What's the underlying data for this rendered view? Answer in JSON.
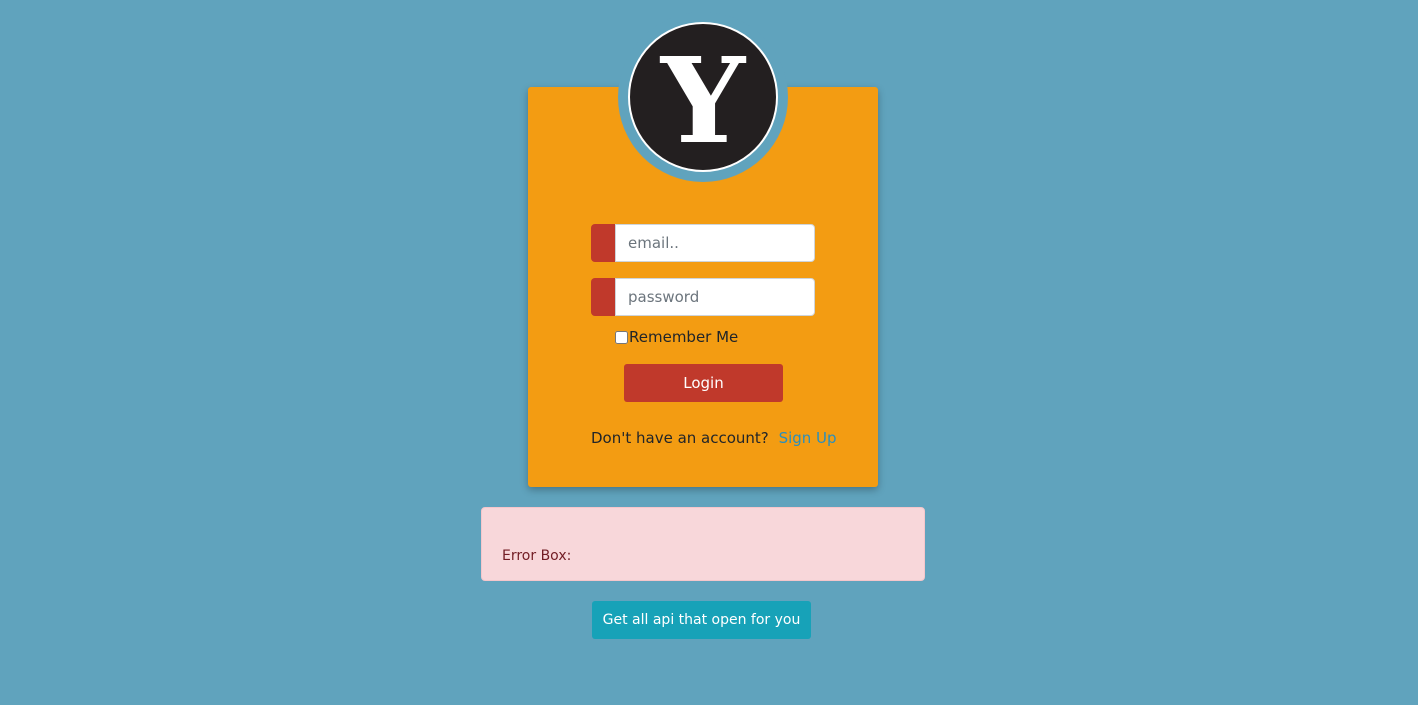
{
  "logo": {
    "letter": "Y"
  },
  "login_form": {
    "email": {
      "placeholder": "email..",
      "value": ""
    },
    "password": {
      "placeholder": "password",
      "value": ""
    },
    "remember_label": "Remember Me",
    "remember_checked": false,
    "login_label": "Login",
    "signup_prompt": "Don't have an account?",
    "signup_link": "Sign Up"
  },
  "error_box": {
    "label": "Error Box:"
  },
  "api_button": {
    "label": "Get all api that open for you"
  },
  "colors": {
    "background": "#60a3bd",
    "card": "#f39c12",
    "accent_red": "#c0392b",
    "logo_dark": "#231f20",
    "link": "#2a8fbd",
    "error_bg": "#f8d7da",
    "error_text": "#721c24",
    "info_button": "#17a2b8"
  }
}
